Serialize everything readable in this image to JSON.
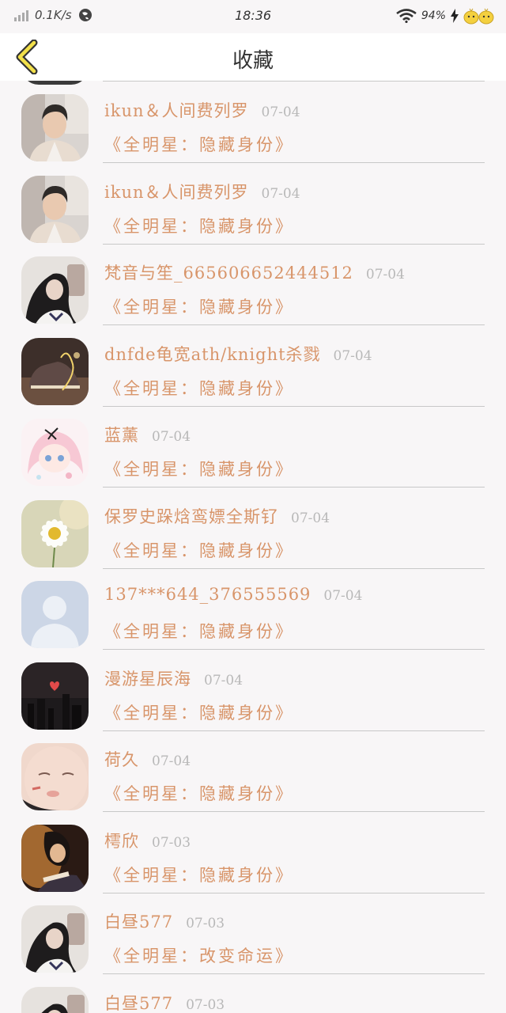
{
  "status": {
    "speed": "0.1K/s",
    "time": "18:36",
    "battery": "94%"
  },
  "header": {
    "title": "收藏"
  },
  "items": [
    {
      "name": "ikun＆人间费列罗",
      "date": "07-04",
      "title": "《全明星：隐藏身份》",
      "avatar": "boy-portrait-avatar"
    },
    {
      "name": "ikun＆人间费列罗",
      "date": "07-04",
      "title": "《全明星：隐藏身份》",
      "avatar": "boy-portrait-avatar"
    },
    {
      "name": "梵音与笙_665606652444512",
      "date": "07-04",
      "title": "《全明星：隐藏身份》",
      "avatar": "girl-selfie-avatar"
    },
    {
      "name": "dnfde龟宽ath/knight杀戮",
      "date": "07-04",
      "title": "《全明星：隐藏身份》",
      "avatar": "sneaker-photo-avatar"
    },
    {
      "name": "蓝薰",
      "date": "07-04",
      "title": "《全明星：隐藏身份》",
      "avatar": "anime-girl-avatar"
    },
    {
      "name": "保罗史跺焓鸾嫖全斯钌",
      "date": "07-04",
      "title": "《全明星：隐藏身份》",
      "avatar": "daisy-flower-avatar"
    },
    {
      "name": "137***644_376555569",
      "date": "07-04",
      "title": "《全明星：隐藏身份》",
      "avatar": "default-user-avatar"
    },
    {
      "name": "漫游星辰海",
      "date": "07-04",
      "title": "《全明星：隐藏身份》",
      "avatar": "night-city-avatar"
    },
    {
      "name": "荷久",
      "date": "07-04",
      "title": "《全明星：隐藏身份》",
      "avatar": "baby-face-avatar"
    },
    {
      "name": "樗欣",
      "date": "07-03",
      "title": "《全明星：隐藏身份》",
      "avatar": "warm-light-avatar"
    },
    {
      "name": "白昼577",
      "date": "07-03",
      "title": "《全明星：改变命运》",
      "avatar": "girl-selfie-avatar"
    },
    {
      "name": "白昼577",
      "date": "07-03",
      "title": "",
      "avatar": "girl-selfie-avatar"
    }
  ]
}
